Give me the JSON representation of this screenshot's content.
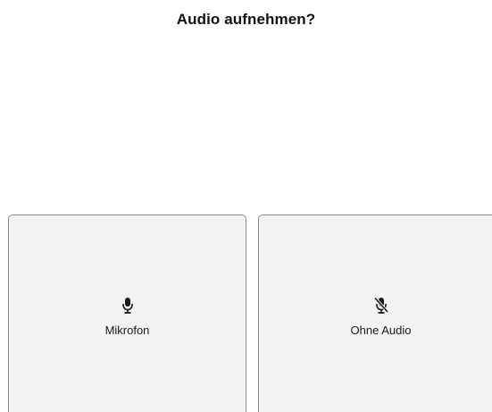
{
  "dialog": {
    "title": "Audio aufnehmen?"
  },
  "options": [
    {
      "label": "Mikrofon",
      "icon": "microphone-icon"
    },
    {
      "label": "Ohne Audio",
      "icon": "microphone-muted-icon"
    }
  ]
}
